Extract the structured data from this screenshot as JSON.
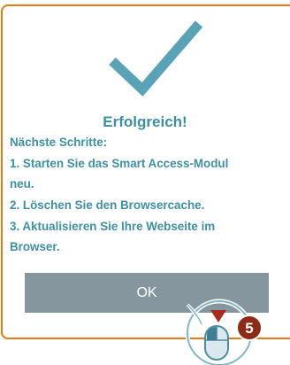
{
  "dialog": {
    "title": "Erfolgreich!",
    "heading": "Nächste Schritte:",
    "lines": [
      "1. Starten Sie das Smart Access-Modul",
      "neu.",
      "2. Löschen Sie den Browsercache.",
      "3. Aktualisieren Sie Ihre Webseite im",
      "Browser."
    ],
    "ok_label": "OK"
  },
  "callout": {
    "number": "5"
  },
  "colors": {
    "accent_text": "#3e8fa3",
    "checkmark": "#5aa3b7",
    "border": "#e07b1a",
    "button_bg": "#86969e",
    "badge_bg": "#8b2a16"
  },
  "icons": {
    "success": "checkmark-icon",
    "pointer": "mouse-click-icon"
  }
}
